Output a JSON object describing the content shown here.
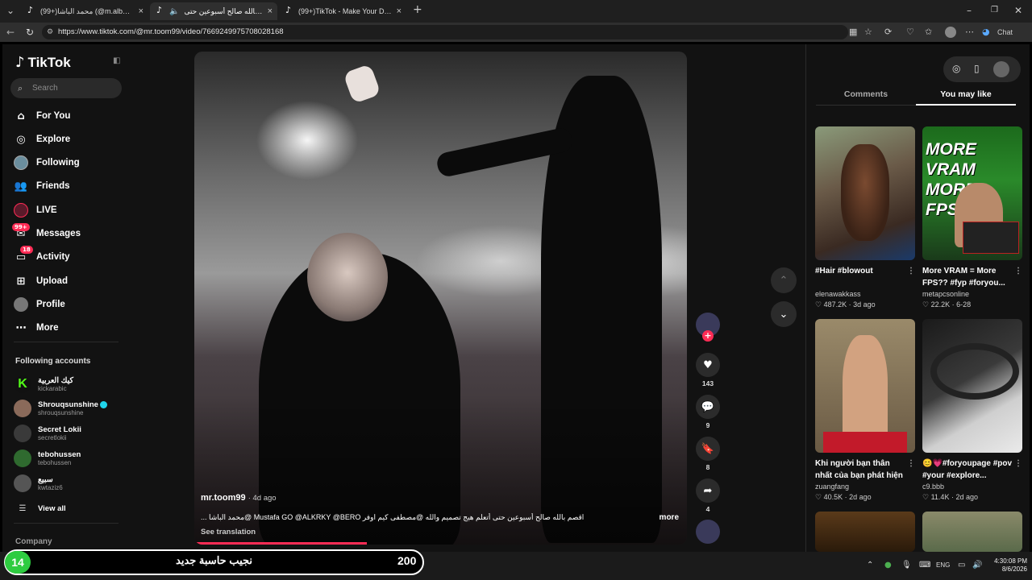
{
  "browser": {
    "tabs": [
      {
        "title": "(99+)محمد الباشا (@m.albasha2) |",
        "active": false
      },
      {
        "title": "اقصم بالله صالح أسبوعين حتى",
        "active": true
      },
      {
        "title": "(99+)TikTok - Make Your Day",
        "active": false
      }
    ],
    "url": "https://www.tiktok.com/@mr.toom99/video/7669249975708028168",
    "chat_label": "Chat",
    "new_tab": "+"
  },
  "sidebar": {
    "logo": "TikTok",
    "search_placeholder": "Search",
    "nav": [
      {
        "label": "For You",
        "icon": "home-icon"
      },
      {
        "label": "Explore",
        "icon": "compass-icon"
      },
      {
        "label": "Following",
        "icon": "following-avatar-icon"
      },
      {
        "label": "Friends",
        "icon": "friends-icon"
      },
      {
        "label": "LIVE",
        "icon": "live-icon"
      },
      {
        "label": "Messages",
        "icon": "messages-icon",
        "badge": "99+"
      },
      {
        "label": "Activity",
        "icon": "activity-icon",
        "badge": "18"
      },
      {
        "label": "Upload",
        "icon": "upload-icon"
      },
      {
        "label": "Profile",
        "icon": "profile-avatar-icon"
      },
      {
        "label": "More",
        "icon": "more-icon"
      }
    ],
    "following_title": "Following accounts",
    "accounts": [
      {
        "name": "كيك العربية",
        "handle": "kickarabic"
      },
      {
        "name": "Shrouqsunshine",
        "handle": "shrouqsunshine",
        "verified": true
      },
      {
        "name": "Secret Lokii",
        "handle": "secretlokii"
      },
      {
        "name": "tebohussen",
        "handle": "tebohussen"
      },
      {
        "name": "سبيع",
        "handle": "kwtaziz6"
      }
    ],
    "view_all": "View all",
    "company": "Company"
  },
  "video": {
    "username": "mr.toom99",
    "age": "4d ago",
    "caption": "اقصم بالله صالح أسبوعين حتى أتعلم هيج تصميم والله  @مصطفى كيم اوفر Mustafa GO @ALKRKY @BERO @محمد الباشا ...",
    "more": "more",
    "see_translation": "See translation",
    "progress": 0.35
  },
  "actions": {
    "likes": "143",
    "comments": "9",
    "saves": "8",
    "shares": "4"
  },
  "right_panel": {
    "tabs": [
      "Comments",
      "You may like"
    ],
    "selected_tab": "You may like",
    "cards": [
      {
        "title": "#Hair #blowout",
        "author": "elenawakkass",
        "likes": "487.2K",
        "age": "3d ago"
      },
      {
        "title": "More VRAM = More FPS?? #fyp #foryou...",
        "author": "metapcsonline",
        "likes": "22.2K",
        "age": "6-28",
        "thumb_text": "MORE VRAM MORE FPS?"
      },
      {
        "title": "Khi người bạn thân nhất của bạn phát hiện ra...",
        "author": "zuangfang",
        "likes": "40.5K",
        "age": "2d ago"
      },
      {
        "title": "😊💗#foryoupage #pov #your #explore...",
        "author": "c9.bbb",
        "likes": "11.4K",
        "age": "2d ago"
      }
    ]
  },
  "overlay": {
    "number": "14",
    "text": "نجيب حاسبة جديد",
    "value": "200"
  },
  "taskbar": {
    "lang": "ENG",
    "time": "4:30:08 PM",
    "date": "8/6/2026"
  },
  "colors": {
    "accent": "#fe2c55",
    "verified": "#20d5ec",
    "overlay_badge": "#2ecc40"
  }
}
